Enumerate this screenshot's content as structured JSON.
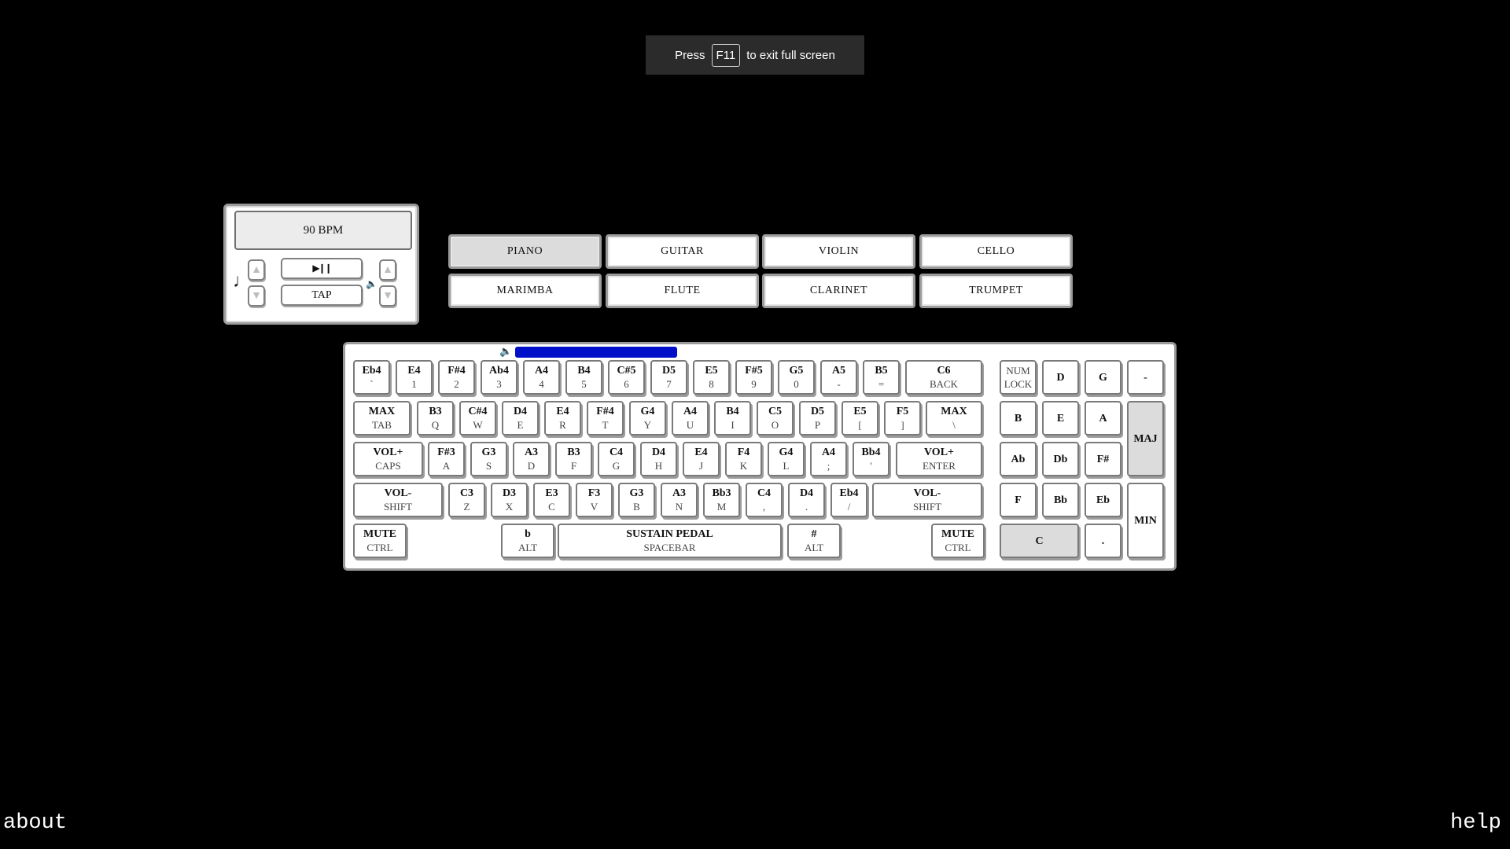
{
  "toast": {
    "pre": "Press",
    "key": "F11",
    "post": "to exit full screen"
  },
  "metronome": {
    "bpm": "90 BPM",
    "play_label": "▶❙❙",
    "tap_label": "TAP",
    "up_glyph": "▲",
    "down_glyph": "▼",
    "note_glyph": "♩",
    "speaker_glyph": "🔈"
  },
  "instruments": [
    "PIANO",
    "GUITAR",
    "VIOLIN",
    "CELLO",
    "MARIMBA",
    "FLUTE",
    "CLARINET",
    "TRUMPET"
  ],
  "active_instrument": "PIANO",
  "volume_fraction": 1.0,
  "keyboard": {
    "row1": [
      [
        "Eb4",
        "`"
      ],
      [
        "E4",
        "1"
      ],
      [
        "F#4",
        "2"
      ],
      [
        "Ab4",
        "3"
      ],
      [
        "A4",
        "4"
      ],
      [
        "B4",
        "5"
      ],
      [
        "C#5",
        "6"
      ],
      [
        "D5",
        "7"
      ],
      [
        "E5",
        "8"
      ],
      [
        "F#5",
        "9"
      ],
      [
        "G5",
        "0"
      ],
      [
        "A5",
        "-"
      ],
      [
        "B5",
        "="
      ],
      [
        "C6",
        "BACK"
      ]
    ],
    "row2": [
      [
        "MAX",
        "TAB"
      ],
      [
        "B3",
        "Q"
      ],
      [
        "C#4",
        "W"
      ],
      [
        "D4",
        "E"
      ],
      [
        "E4",
        "R"
      ],
      [
        "F#4",
        "T"
      ],
      [
        "G4",
        "Y"
      ],
      [
        "A4",
        "U"
      ],
      [
        "B4",
        "I"
      ],
      [
        "C5",
        "O"
      ],
      [
        "D5",
        "P"
      ],
      [
        "E5",
        "["
      ],
      [
        "F5",
        "]"
      ],
      [
        "MAX",
        "\\"
      ]
    ],
    "row3": [
      [
        "VOL+",
        "CAPS"
      ],
      [
        "F#3",
        "A"
      ],
      [
        "G3",
        "S"
      ],
      [
        "A3",
        "D"
      ],
      [
        "B3",
        "F"
      ],
      [
        "C4",
        "G"
      ],
      [
        "D4",
        "H"
      ],
      [
        "E4",
        "J"
      ],
      [
        "F4",
        "K"
      ],
      [
        "G4",
        "L"
      ],
      [
        "A4",
        ";"
      ],
      [
        "Bb4",
        "'"
      ],
      [
        "VOL+",
        "ENTER"
      ]
    ],
    "row4": [
      [
        "VOL-",
        "SHIFT"
      ],
      [
        "C3",
        "Z"
      ],
      [
        "D3",
        "X"
      ],
      [
        "E3",
        "C"
      ],
      [
        "F3",
        "V"
      ],
      [
        "G3",
        "B"
      ],
      [
        "A3",
        "N"
      ],
      [
        "Bb3",
        "M"
      ],
      [
        "C4",
        ","
      ],
      [
        "D4",
        "."
      ],
      [
        "Eb4",
        "/"
      ],
      [
        "VOL-",
        "SHIFT"
      ]
    ],
    "row5": [
      [
        "MUTE",
        "CTRL"
      ],
      [
        "b",
        "ALT"
      ],
      [
        "SUSTAIN PEDAL",
        "SPACEBAR"
      ],
      [
        "#",
        "ALT"
      ],
      [
        "MUTE",
        "CTRL"
      ]
    ]
  },
  "numpad": {
    "numlock": [
      "NUM",
      "LOCK"
    ],
    "keys": [
      "D",
      "G",
      "-",
      "B",
      "E",
      "A",
      "Ab",
      "Db",
      "F#",
      "F",
      "Bb",
      "Eb",
      "C",
      "."
    ],
    "maj": "MAJ",
    "min": "MIN",
    "selected_key": "C"
  },
  "footer": {
    "about": "about",
    "help": "help"
  }
}
